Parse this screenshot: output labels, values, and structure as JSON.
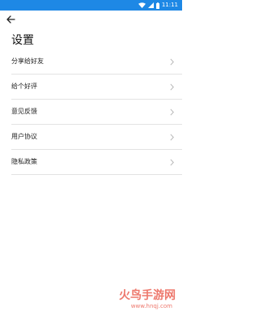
{
  "status_bar": {
    "time": "11:11",
    "background_color": "#1e88e5",
    "icons": [
      "wifi-icon",
      "signal-icon",
      "battery-icon"
    ]
  },
  "header": {
    "back_icon": "arrow-left-icon",
    "title": "设置"
  },
  "menu": {
    "items": [
      {
        "label": "分享给好友",
        "icon": "chevron-right-icon"
      },
      {
        "label": "给个好评",
        "icon": "chevron-right-icon"
      },
      {
        "label": "意见反馈",
        "icon": "chevron-right-icon"
      },
      {
        "label": "用户协议",
        "icon": "chevron-right-icon"
      },
      {
        "label": "隐私政策",
        "icon": "chevron-right-icon"
      }
    ]
  },
  "watermark": {
    "text": "火鸟手游网",
    "url": "www.hnqj.com",
    "color": "#e84b3c"
  }
}
